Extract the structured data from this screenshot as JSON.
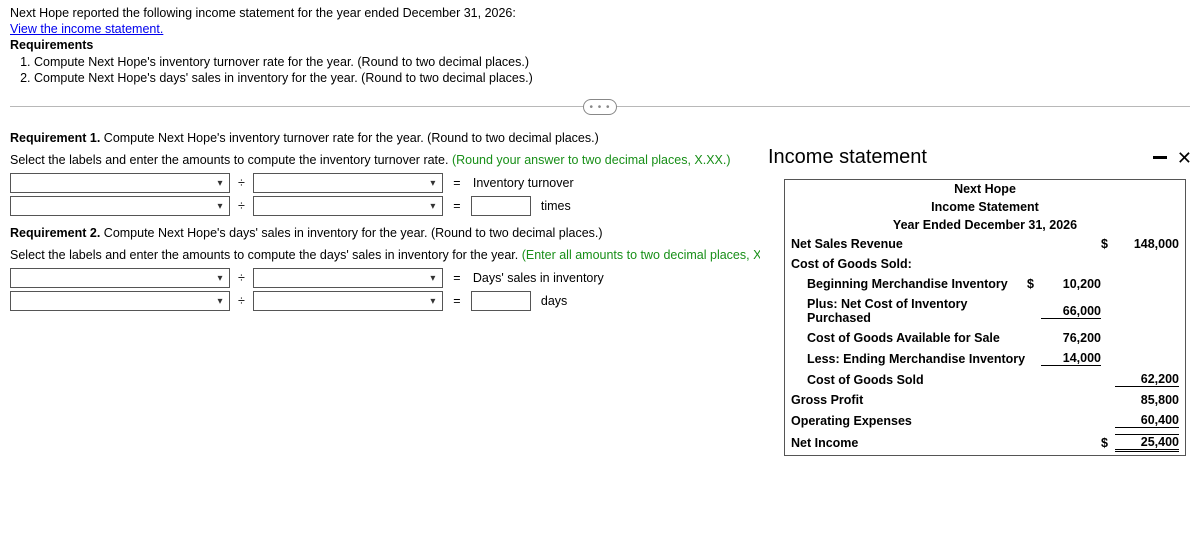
{
  "intro": {
    "line1": "Next Hope reported the following income statement for the year ended December 31, 2026:",
    "link": "View the income statement.",
    "req_title": "Requirements",
    "req1": "Compute Next Hope's inventory turnover rate for the year. (Round to two decimal places.)",
    "req2": "Compute Next Hope's days' sales in inventory for the year. (Round to two decimal places.)"
  },
  "more": "• • •",
  "r1": {
    "title_bold": "Requirement 1.",
    "title_rest": " Compute Next Hope's inventory turnover rate for the year. (Round to two decimal places.)",
    "sub_a": "Select the labels and enter the amounts to compute the inventory turnover rate. ",
    "sub_b": "(Round your answer to two decimal places, X.XX.)",
    "result_label": "Inventory turnover",
    "unit": "times",
    "op": "÷",
    "eq": "="
  },
  "r2": {
    "title_bold": "Requirement 2.",
    "title_rest": " Compute Next Hope's days' sales in inventory for the year. (Round to two decimal places.)",
    "sub_a": "Select the labels and enter the amounts to compute the days' sales in inventory for the year. ",
    "sub_b": "(Enter all amounts to two decimal places, X.XX.)",
    "result_label": "Days' sales in inventory",
    "unit": "days",
    "op": "÷",
    "eq": "="
  },
  "popup": {
    "title": "Income statement",
    "company": "Next Hope",
    "stmt_name": "Income Statement",
    "period": "Year Ended December 31, 2026",
    "rows": {
      "net_sales": "Net Sales Revenue",
      "net_sales_amt": "148,000",
      "cogs_header": "Cost of Goods Sold:",
      "beg_inv": "Beginning Merchandise Inventory",
      "beg_inv_amt": "10,200",
      "purchases": "Plus: Net Cost of Inventory Purchased",
      "purchases_amt": "66,000",
      "avail": "Cost of Goods Available for Sale",
      "avail_amt": "76,200",
      "end_inv": "Less: Ending Merchandise Inventory",
      "end_inv_amt": "14,000",
      "cogs": "Cost of Goods Sold",
      "cogs_amt": "62,200",
      "gross": "Gross Profit",
      "gross_amt": "85,800",
      "opex": "Operating Expenses",
      "opex_amt": "60,400",
      "ni": "Net Income",
      "ni_amt": "25,400",
      "cur": "$"
    }
  },
  "chart_data": {
    "type": "table",
    "title": "Next Hope Income Statement, Year Ended December 31, 2026",
    "rows": [
      {
        "label": "Net Sales Revenue",
        "value": 148000
      },
      {
        "label": "Beginning Merchandise Inventory",
        "value": 10200
      },
      {
        "label": "Plus: Net Cost of Inventory Purchased",
        "value": 66000
      },
      {
        "label": "Cost of Goods Available for Sale",
        "value": 76200
      },
      {
        "label": "Less: Ending Merchandise Inventory",
        "value": 14000
      },
      {
        "label": "Cost of Goods Sold",
        "value": 62200
      },
      {
        "label": "Gross Profit",
        "value": 85800
      },
      {
        "label": "Operating Expenses",
        "value": 60400
      },
      {
        "label": "Net Income",
        "value": 25400
      }
    ]
  }
}
